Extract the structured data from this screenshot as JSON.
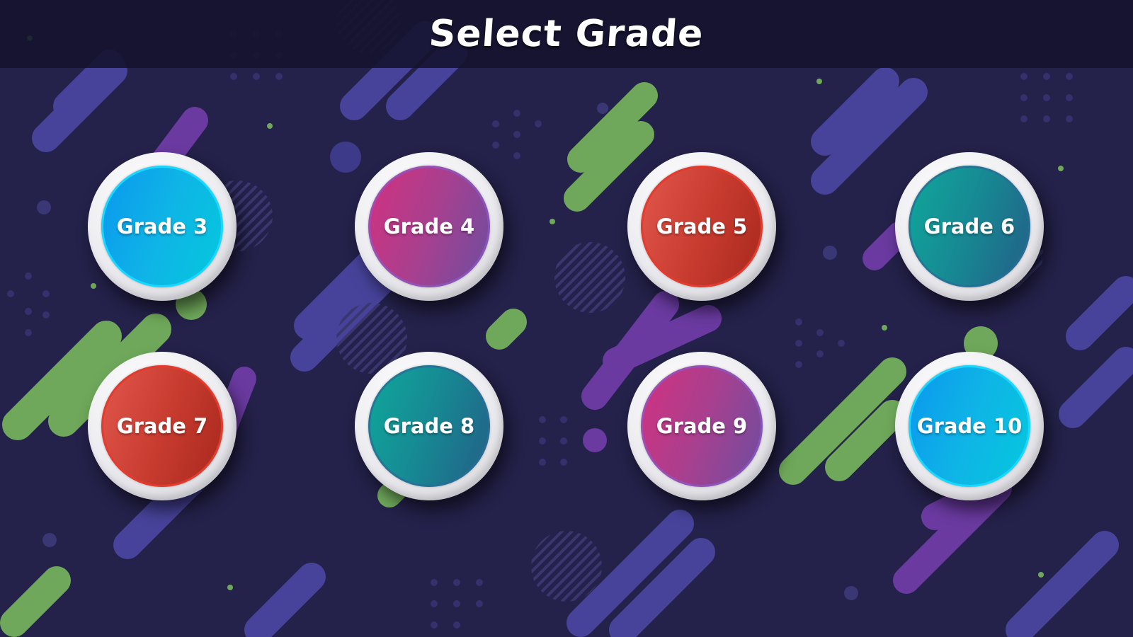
{
  "header": {
    "title": "Select Grade"
  },
  "grades": [
    {
      "label": "Grade 3",
      "color": "blue"
    },
    {
      "label": "Grade 4",
      "color": "magenta"
    },
    {
      "label": "Grade 5",
      "color": "red"
    },
    {
      "label": "Grade 6",
      "color": "teal"
    },
    {
      "label": "Grade 7",
      "color": "red"
    },
    {
      "label": "Grade 8",
      "color": "teal"
    },
    {
      "label": "Grade 9",
      "color": "magenta"
    },
    {
      "label": "Grade 10",
      "color": "blue"
    }
  ],
  "theme": {
    "background": "#24214a",
    "header_bar": "#14122c",
    "accent_purple": "#4a3f9a",
    "accent_violet": "#6a3aa0",
    "accent_green": "#6fa85a"
  }
}
